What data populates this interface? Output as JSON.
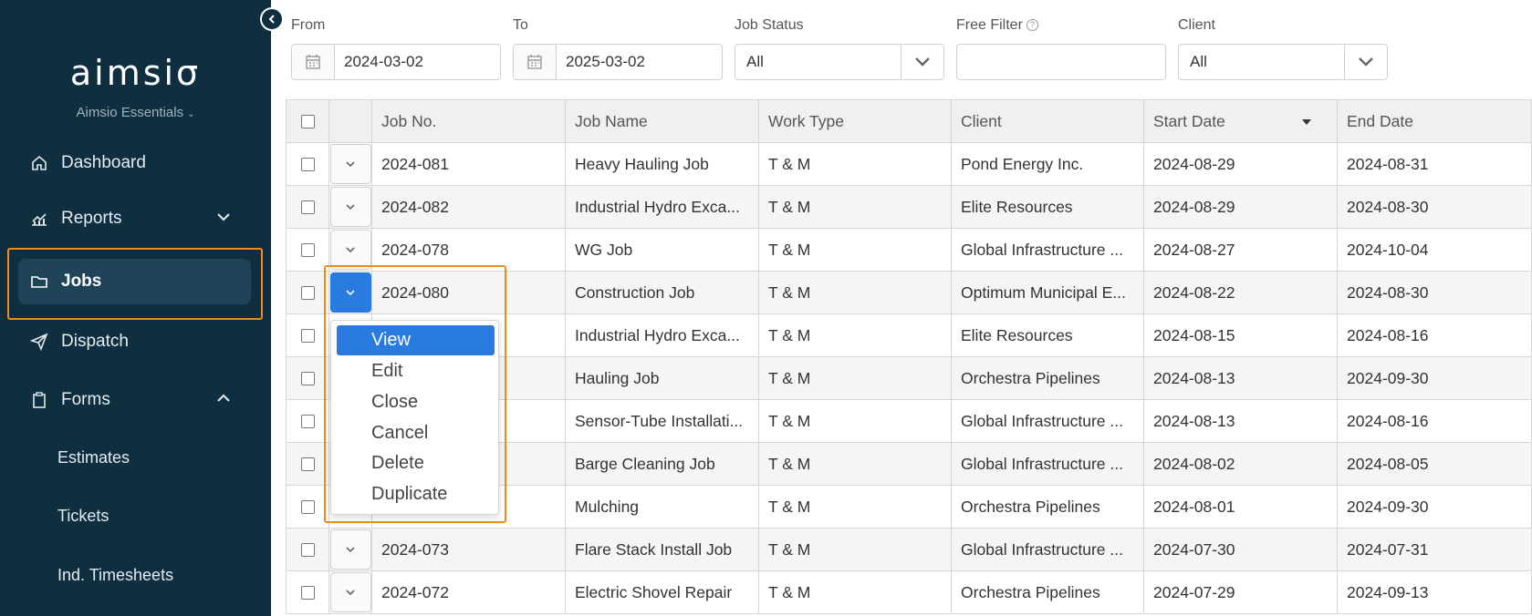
{
  "sidebar": {
    "logo_text": "aimsiσ",
    "org_name": "Aimsio Essentials",
    "items": [
      {
        "label": "Dashboard"
      },
      {
        "label": "Reports"
      },
      {
        "label": "Jobs"
      },
      {
        "label": "Dispatch"
      },
      {
        "label": "Forms"
      }
    ],
    "sub_items": [
      {
        "label": "Estimates"
      },
      {
        "label": "Tickets"
      },
      {
        "label": "Ind. Timesheets"
      }
    ]
  },
  "filters": {
    "from_label": "From",
    "from_value": "2024-03-02",
    "to_label": "To",
    "to_value": "2025-03-02",
    "status_label": "Job Status",
    "status_value": "All",
    "free_filter_label": "Free Filter",
    "free_filter_value": "",
    "client_label": "Client",
    "client_value": "All"
  },
  "table": {
    "columns": [
      "Job No.",
      "Job Name",
      "Work Type",
      "Client",
      "Start Date",
      "End Date"
    ],
    "rows": [
      {
        "job_no": "2024-081",
        "job_name": "Heavy Hauling Job",
        "work_type": "T & M",
        "client": "Pond Energy Inc.",
        "start": "2024-08-29",
        "end": "2024-08-31"
      },
      {
        "job_no": "2024-082",
        "job_name": "Industrial Hydro Exca...",
        "work_type": "T & M",
        "client": "Elite Resources",
        "start": "2024-08-29",
        "end": "2024-08-30"
      },
      {
        "job_no": "2024-078",
        "job_name": "WG Job",
        "work_type": "T & M",
        "client": "Global Infrastructure ...",
        "start": "2024-08-27",
        "end": "2024-10-04"
      },
      {
        "job_no": "2024-080",
        "job_name": "Construction Job",
        "work_type": "T & M",
        "client": "Optimum Municipal E...",
        "start": "2024-08-22",
        "end": "2024-08-30"
      },
      {
        "job_no": "",
        "job_name": "Industrial Hydro Exca...",
        "work_type": "T & M",
        "client": "Elite Resources",
        "start": "2024-08-15",
        "end": "2024-08-16"
      },
      {
        "job_no": "",
        "job_name": "Hauling Job",
        "work_type": "T & M",
        "client": "Orchestra Pipelines",
        "start": "2024-08-13",
        "end": "2024-09-30"
      },
      {
        "job_no": "",
        "job_name": "Sensor-Tube Installati...",
        "work_type": "T & M",
        "client": "Global Infrastructure ...",
        "start": "2024-08-13",
        "end": "2024-08-16"
      },
      {
        "job_no": "",
        "job_name": "Barge Cleaning Job",
        "work_type": "T & M",
        "client": "Global Infrastructure ...",
        "start": "2024-08-02",
        "end": "2024-08-05"
      },
      {
        "job_no": "",
        "job_name": "Mulching",
        "work_type": "T & M",
        "client": "Orchestra Pipelines",
        "start": "2024-08-01",
        "end": "2024-09-30"
      },
      {
        "job_no": "2024-073",
        "job_name": "Flare Stack Install Job",
        "work_type": "T & M",
        "client": "Global Infrastructure ...",
        "start": "2024-07-30",
        "end": "2024-07-31"
      },
      {
        "job_no": "2024-072",
        "job_name": "Electric Shovel Repair",
        "work_type": "T & M",
        "client": "Orchestra Pipelines",
        "start": "2024-07-29",
        "end": "2024-09-13"
      }
    ]
  },
  "row_menu": {
    "items": [
      "View",
      "Edit",
      "Close",
      "Cancel",
      "Delete",
      "Duplicate"
    ],
    "selected": "View"
  },
  "colors": {
    "sidebar_bg": "#0f2e40",
    "accent_blue": "#2a7be0",
    "highlight_orange": "#f08a1c"
  }
}
